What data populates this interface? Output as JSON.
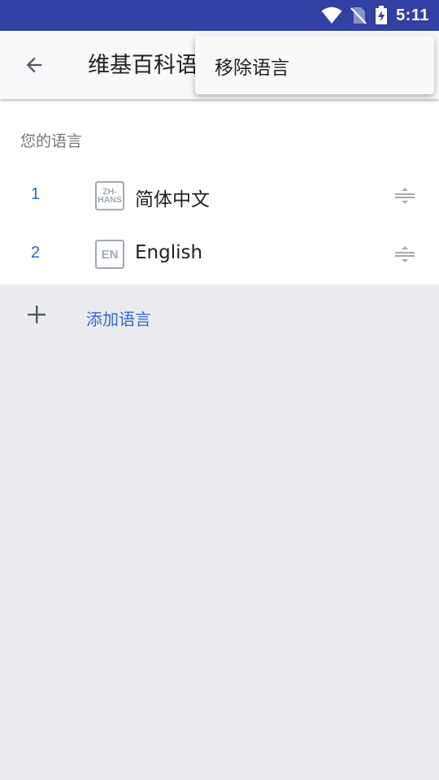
{
  "status_bar": {
    "time": "5:11",
    "icons": [
      "wifi-icon",
      "no-sim-icon",
      "battery-charging-icon"
    ]
  },
  "toolbar": {
    "title": "维基百科语言",
    "back_icon": "arrow-back-icon"
  },
  "popup_menu": {
    "items": [
      {
        "label": "移除语言"
      }
    ]
  },
  "languages_section": {
    "header": "您的语言",
    "items": [
      {
        "number": "1",
        "code_lines": [
          "ZH-",
          "HANS"
        ],
        "name": "简体中文"
      },
      {
        "number": "2",
        "code_lines": [
          "EN"
        ],
        "name": "English"
      }
    ]
  },
  "add_language": {
    "label": "添加语言"
  },
  "colors": {
    "status_bar": "#3140a3",
    "accent": "#3366cc",
    "text_primary": "#202122",
    "text_secondary": "#72777d",
    "background": "#eaecf0"
  }
}
